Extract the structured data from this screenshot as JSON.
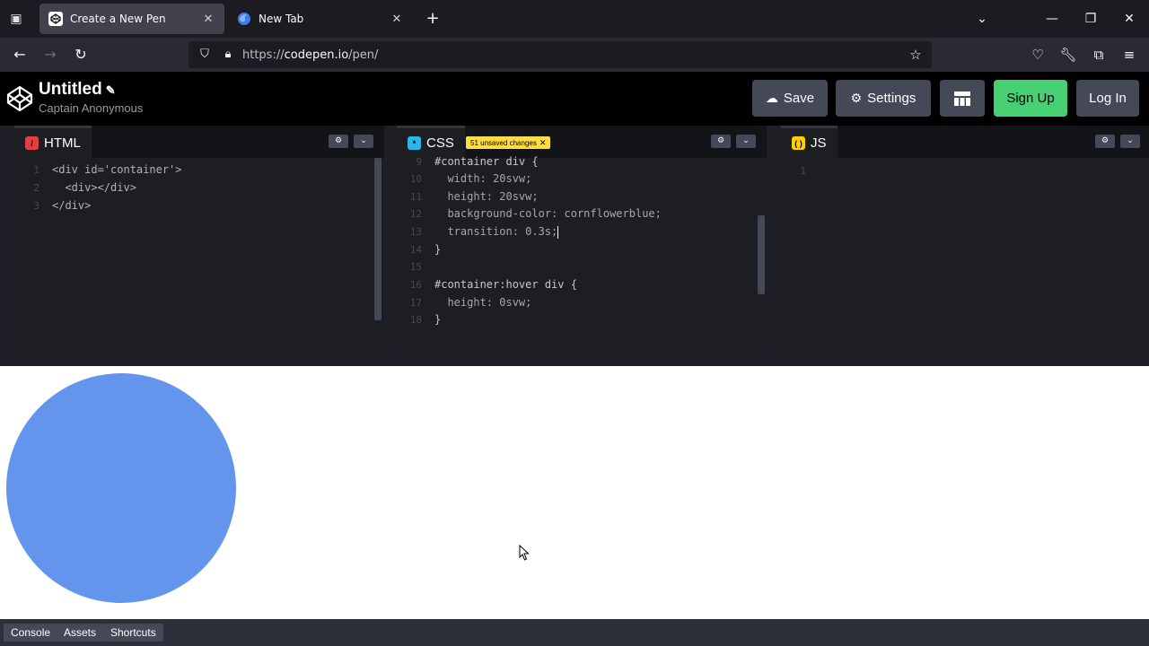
{
  "browser": {
    "tabs": [
      {
        "title": "Create a New Pen",
        "active": true
      },
      {
        "title": "New Tab",
        "active": false
      }
    ],
    "url_prefix": "https://",
    "url_host": "codepen.io",
    "url_path": "/pen/"
  },
  "header": {
    "title": "Untitled",
    "author": "Captain Anonymous",
    "save_label": "Save",
    "settings_label": "Settings",
    "signup_label": "Sign Up",
    "login_label": "Log In"
  },
  "editors": {
    "html": {
      "label": "HTML",
      "lines": [
        {
          "n": "1",
          "code": "<div id='container'>"
        },
        {
          "n": "2",
          "code": "  <div></div>"
        },
        {
          "n": "3",
          "code": "</div>"
        }
      ]
    },
    "css": {
      "label": "CSS",
      "badge": "51 unsaved changes",
      "lines": [
        {
          "n": "9",
          "code": "#container div {"
        },
        {
          "n": "10",
          "code": "  width: 20svw;"
        },
        {
          "n": "11",
          "code": "  height: 20svw;"
        },
        {
          "n": "12",
          "code": "  background-color: cornflowerblue;"
        },
        {
          "n": "13",
          "code": "  transition: 0.3s;"
        },
        {
          "n": "14",
          "code": "}"
        },
        {
          "n": "15",
          "code": ""
        },
        {
          "n": "16",
          "code": "#container:hover div {"
        },
        {
          "n": "17",
          "code": "  height: 0svw;"
        },
        {
          "n": "18",
          "code": "}"
        }
      ]
    },
    "js": {
      "label": "JS",
      "lines": [
        {
          "n": "1",
          "code": ""
        }
      ]
    }
  },
  "footer": {
    "console_label": "Console",
    "assets_label": "Assets",
    "shortcuts_label": "Shortcuts"
  },
  "colors": {
    "preview_circle": "#6495ed",
    "signup_green": "#47cf73",
    "badge_yellow": "#ffdd40"
  }
}
